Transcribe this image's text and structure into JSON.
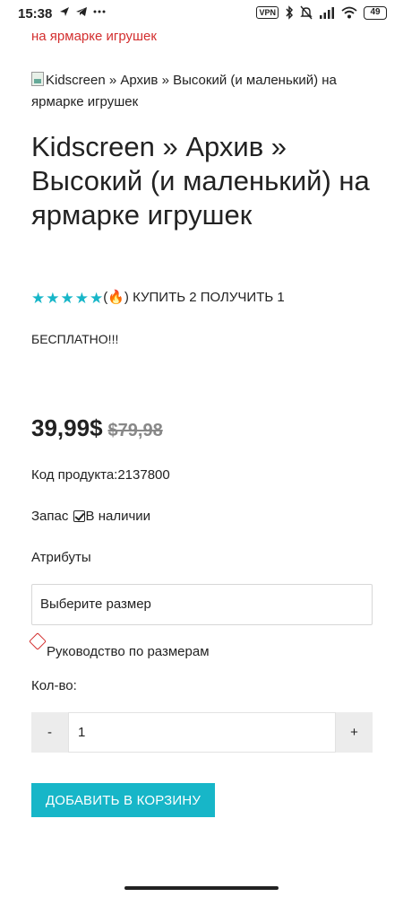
{
  "status_bar": {
    "time": "15:38",
    "left_icons": [
      "nav-arrow-icon",
      "telegram-icon",
      "more-dots-icon"
    ],
    "vpn": "VPN",
    "right_icons": [
      "bluetooth-icon",
      "mute-icon",
      "signal-icon",
      "wifi-icon"
    ],
    "battery": "49"
  },
  "cut_link_text": "на ярмарке игрушек",
  "image_alt": "Kidscreen » Архив » Высокий (и маленький) на ярмарке игрушек",
  "product": {
    "title": "Kidscreen » Архив » Высокий (и маленький) на ярмарке игрушек",
    "rating_stars": 5,
    "promo_text": "(🔥) КУПИТЬ 2 ПОЛУЧИТЬ 1",
    "promo_text_2": "БЕСПЛАТНО!!!",
    "price_current": "39,99$",
    "price_old": "$79,98",
    "sku_label": "Код продукта:",
    "sku_value": "2137800",
    "stock_label": "Запас",
    "stock_value": "В наличии"
  },
  "attributes": {
    "label": "Атрибуты",
    "size_select_value": "Выберите размер",
    "size_guide": "Руководство по размерам"
  },
  "quantity": {
    "label": "Кол-во:",
    "minus": "-",
    "value": "1",
    "plus": "+"
  },
  "add_to_cart": "ДОБАВИТЬ В КОРЗИНУ",
  "colors": {
    "accent": "#17b6c8",
    "link_red": "#d32f2f"
  }
}
